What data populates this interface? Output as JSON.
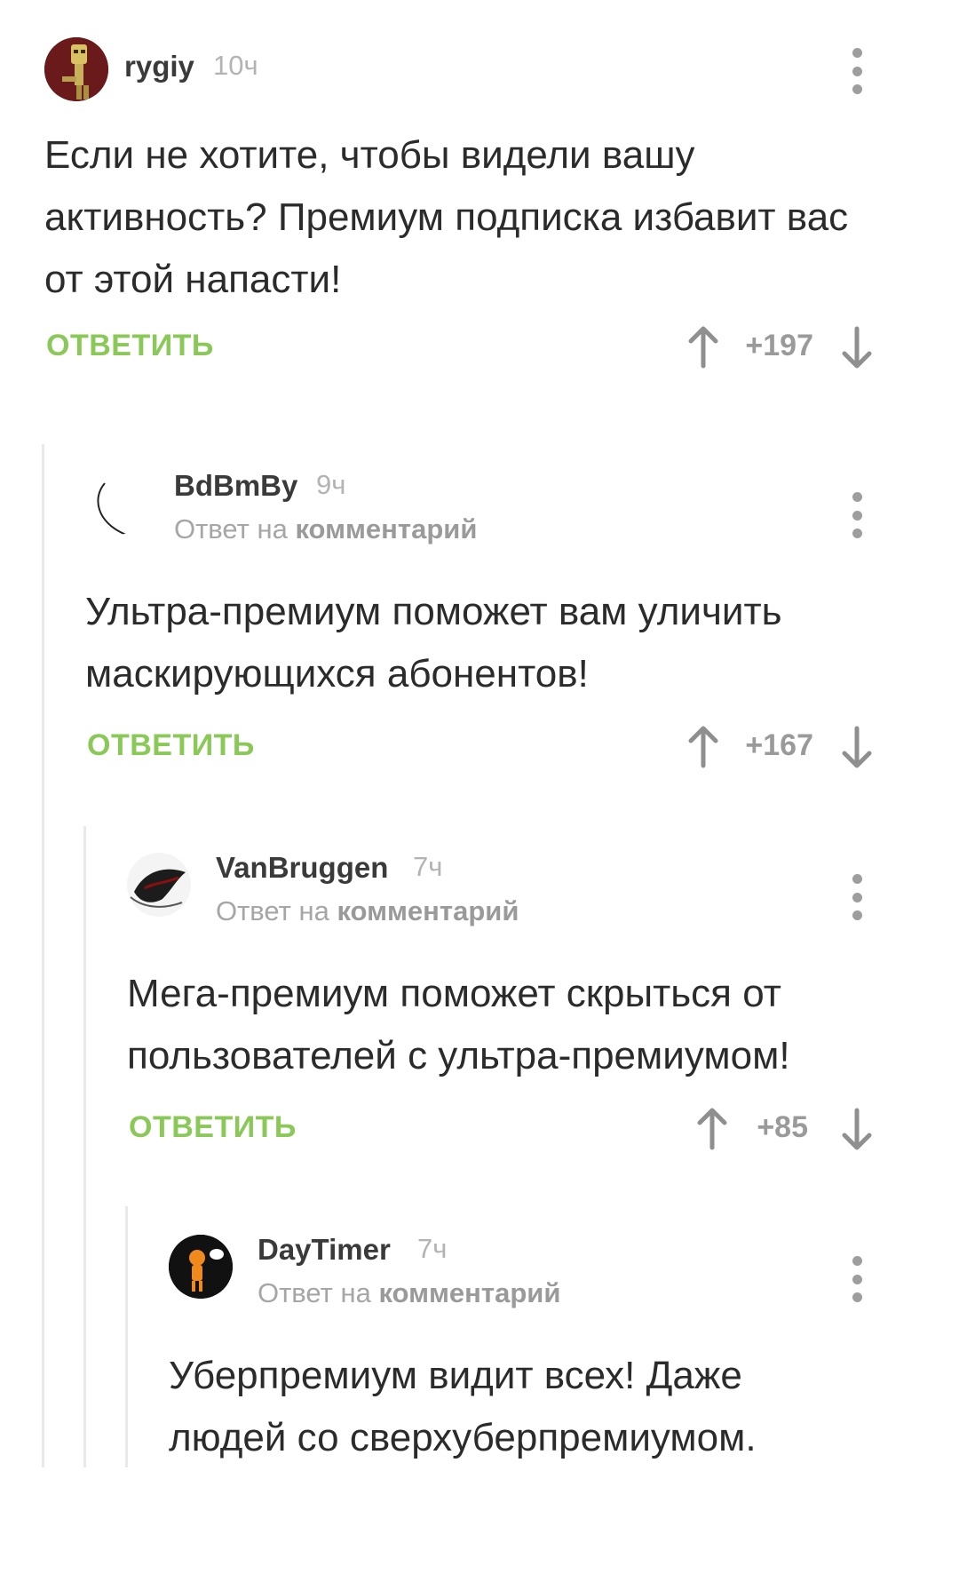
{
  "comments": [
    {
      "username": "rygiy",
      "time": "10ч",
      "reply_prefix": "",
      "reply_link": "",
      "text": "Если не хотите, чтобы видели вашу активность? Премиум подписка избавит вас от этой напасти!",
      "reply_label": "ОТВЕТИТЬ",
      "score": "+197",
      "avatar_icon": "robot-avatar"
    },
    {
      "username": "BdBmBy",
      "time": "9ч",
      "reply_prefix": "Ответ на ",
      "reply_link": "комментарий",
      "text": "Ультра-премиум поможет вам уличить маскирующихся абонентов!",
      "reply_label": "ОТВЕТИТЬ",
      "score": "+167",
      "avatar_icon": "crescent-sketch-avatar"
    },
    {
      "username": "VanBruggen",
      "time": "7ч",
      "reply_prefix": "Ответ на ",
      "reply_link": "комментарий",
      "text": "Мега-премиум поможет скрыться от пользователей с ультра-премиумом!",
      "reply_label": "ОТВЕТИТЬ",
      "score": "+85",
      "avatar_icon": "dark-creature-avatar"
    },
    {
      "username": "DayTimer",
      "time": "7ч",
      "reply_prefix": "Ответ на ",
      "reply_link": "комментарий",
      "text": "Уберпремиум видит всех! Даже людей со сверхуберпремиумом.",
      "reply_label": "",
      "score": "",
      "avatar_icon": "orange-figure-avatar"
    }
  ],
  "colors": {
    "accent_green": "#8ac858",
    "username": "#3a3a3a",
    "meta_gray": "#b3b3b3",
    "thread_line": "#e9e9e9"
  }
}
